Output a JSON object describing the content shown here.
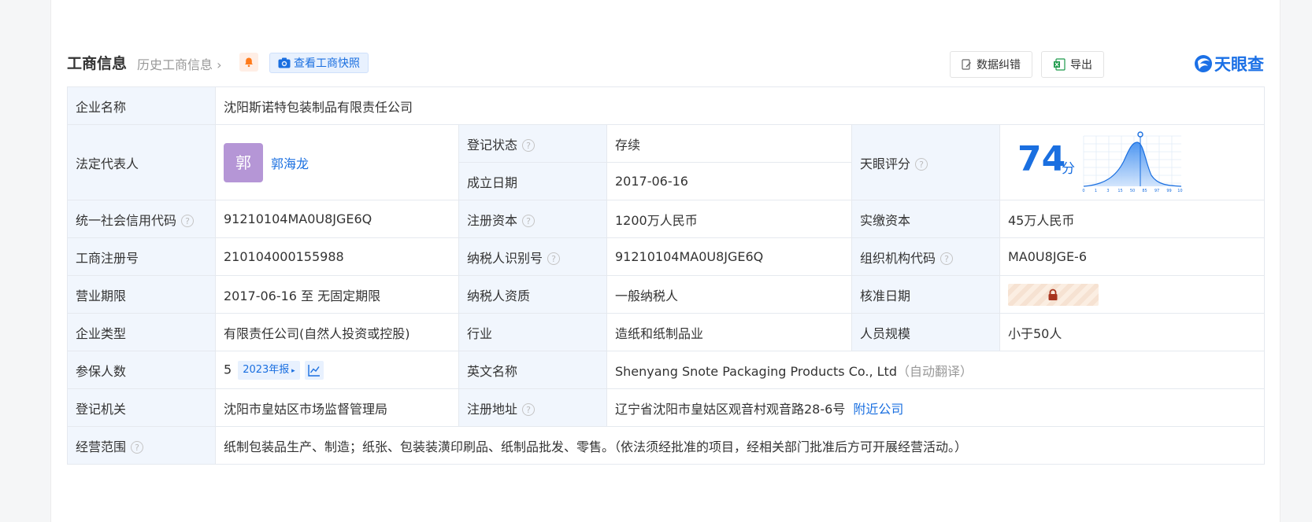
{
  "header": {
    "title": "工商信息",
    "history": "历史工商信息",
    "snapshot_label": "查看工商快照",
    "correct_label": "数据纠错",
    "export_label": "导出",
    "logo_text": "天眼查"
  },
  "colors": {
    "accent": "#1a6fe0",
    "label_bg": "#f1f6fd",
    "status_green": "#1d9a4b",
    "avatar_bg": "#b596d6"
  },
  "info": {
    "company_name_label": "企业名称",
    "company_name": "沈阳斯诺特包装制品有限责任公司",
    "legal_rep_label": "法定代表人",
    "legal_rep_avatar": "郭",
    "legal_rep_name": "郭海龙",
    "status_label": "登记状态",
    "status": "存续",
    "found_date_label": "成立日期",
    "found_date": "2017-06-16",
    "score_label": "天眼评分",
    "score": "74",
    "score_unit": "分",
    "score_axis": [
      "0",
      "1",
      "3",
      "15",
      "50",
      "85",
      "97",
      "99",
      "100"
    ],
    "credit_code_label": "统一社会信用代码",
    "credit_code": "91210104MA0U8JGE6Q",
    "reg_capital_label": "注册资本",
    "reg_capital": "1200万人民币",
    "paid_capital_label": "实缴资本",
    "paid_capital": "45万人民币",
    "reg_no_label": "工商注册号",
    "reg_no": "210104000155988",
    "taxpayer_id_label": "纳税人识别号",
    "taxpayer_id": "91210104MA0U8JGE6Q",
    "org_code_label": "组织机构代码",
    "org_code": "MA0U8JGE-6",
    "term_label": "营业期限",
    "term": "2017-06-16 至 无固定期限",
    "taxpayer_qual_label": "纳税人资质",
    "taxpayer_qual": "一般纳税人",
    "approve_date_label": "核准日期",
    "company_type_label": "企业类型",
    "company_type": "有限责任公司(自然人投资或控股)",
    "industry_label": "行业",
    "industry": "造纸和纸制品业",
    "staff_size_label": "人员规模",
    "staff_size": "小于50人",
    "insured_label": "参保人数",
    "insured": "5",
    "insured_report": "2023年报",
    "english_name_label": "英文名称",
    "english_name": "Shenyang Snote Packaging Products Co., Ltd",
    "auto_translate": "（自动翻译）",
    "authority_label": "登记机关",
    "authority": "沈阳市皇姑区市场监督管理局",
    "address_label": "注册地址",
    "address": "辽宁省沈阳市皇姑区观音村观音路28-6号",
    "nearby_label": "附近公司",
    "scope_label": "经营范围",
    "scope": "纸制包装品生产、制造；纸张、包装装潢印刷品、纸制品批发、零售。（依法须经批准的项目，经相关部门批准后方可开展经营活动。）"
  }
}
